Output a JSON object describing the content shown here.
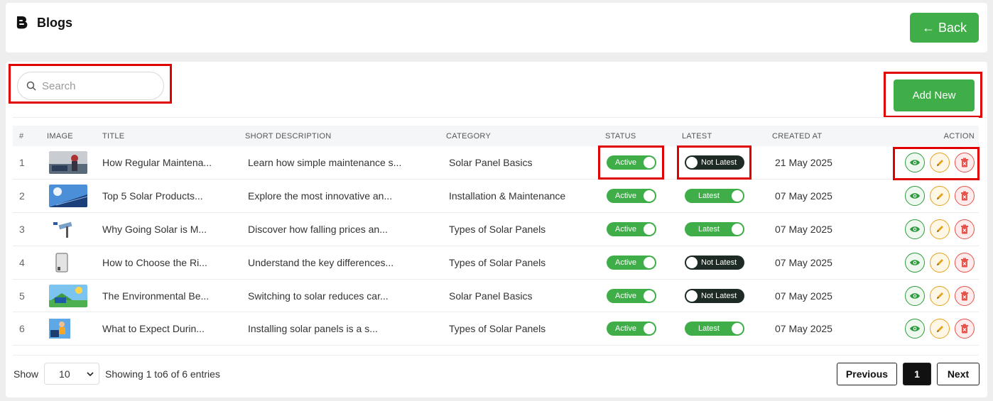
{
  "header": {
    "title": "Blogs",
    "back_label": "← Back"
  },
  "search": {
    "placeholder": "Search"
  },
  "add_new_label": "Add New",
  "table": {
    "columns": [
      "#",
      "IMAGE",
      "TITLE",
      "SHORT DESCRIPTION",
      "CATEGORY",
      "STATUS",
      "LATEST",
      "CREATED AT",
      "ACTION"
    ],
    "rows": [
      {
        "num": "1",
        "title": "How Regular Maintena...",
        "desc": "Learn how simple maintenance s...",
        "category": "Solar Panel Basics",
        "status": "Active",
        "latest": "Not Latest",
        "created": "21 May 2025",
        "thumb": "maintenance-photo"
      },
      {
        "num": "2",
        "title": "Top 5 Solar Products...",
        "desc": "Explore the most innovative an...",
        "category": "Installation & Maintenance",
        "status": "Active",
        "latest": "Latest",
        "created": "07 May 2025",
        "thumb": "solar-panels-photo"
      },
      {
        "num": "3",
        "title": "Why Going Solar is M...",
        "desc": "Discover how falling prices an...",
        "category": "Types of Solar Panels",
        "status": "Active",
        "latest": "Latest",
        "created": "07 May 2025",
        "thumb": "solar-device-photo"
      },
      {
        "num": "4",
        "title": "How to Choose the Ri...",
        "desc": "Understand the key differences...",
        "category": "Types of Solar Panels",
        "status": "Active",
        "latest": "Not Latest",
        "created": "07 May 2025",
        "thumb": "inverter-photo"
      },
      {
        "num": "5",
        "title": "The Environmental Be...",
        "desc": "Switching to solar reduces car...",
        "category": "Solar Panel Basics",
        "status": "Active",
        "latest": "Not Latest",
        "created": "07 May 2025",
        "thumb": "landscape-photo"
      },
      {
        "num": "6",
        "title": "What to Expect Durin...",
        "desc": "Installing solar panels is a s...",
        "category": "Types of Solar Panels",
        "status": "Active",
        "latest": "Latest",
        "created": "07 May 2025",
        "thumb": "installer-photo"
      }
    ]
  },
  "footer": {
    "show_label": "Show",
    "page_size": "10",
    "showing_text": "Showing 1  to6  of 6 entries",
    "prev_label": "Previous",
    "current_page": "1",
    "next_label": "Next"
  },
  "colors": {
    "accent": "#3fae49",
    "highlight": "#e00000",
    "dark_toggle": "#1d2b24"
  }
}
